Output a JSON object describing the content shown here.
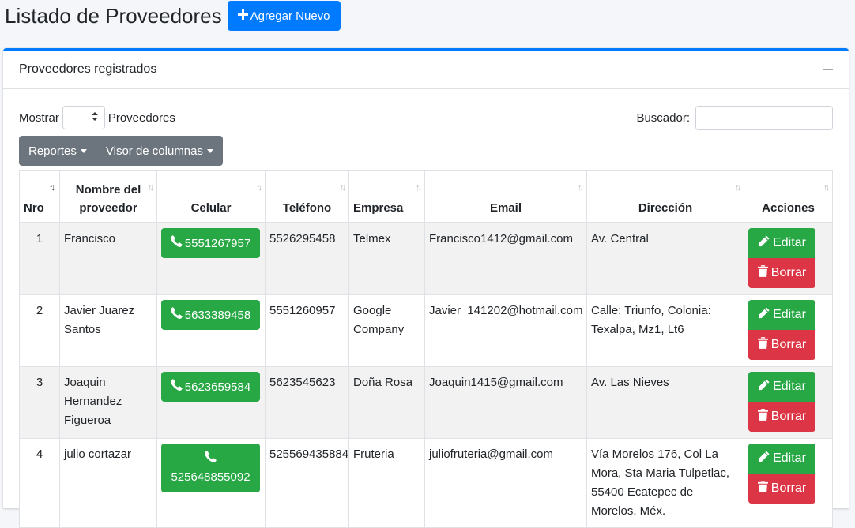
{
  "header": {
    "title": "Listado de Proveedores",
    "add_label": "Agregar Nuevo"
  },
  "card": {
    "title": "Proveedores registrados"
  },
  "controls": {
    "show_label": "Mostrar",
    "show_suffix": "Proveedores",
    "search_label": "Buscador:",
    "reports_label": "Reportes",
    "columns_label": "Visor de columnas"
  },
  "table": {
    "columns": [
      "Nro",
      "Nombre del proveedor",
      "Celular",
      "Teléfono",
      "Empresa",
      "Email",
      "Dirección",
      "Acciones"
    ],
    "edit_label": "Editar",
    "delete_label": "Borrar",
    "rows": [
      {
        "nro": "1",
        "nombre": "Francisco",
        "celular": "5551267957",
        "telefono": "5526295458",
        "empresa": "Telmex",
        "email": "Francisco1412@gmail.com",
        "direccion": "Av. Central"
      },
      {
        "nro": "2",
        "nombre": "Javier Juarez Santos",
        "celular": "5633389458",
        "telefono": "5551260957",
        "empresa": "Google Company",
        "email": "Javier_141202@hotmail.com",
        "direccion": "Calle: Triunfo, Colonia: Texalpa, Mz1, Lt6"
      },
      {
        "nro": "3",
        "nombre": "Joaquin Hernandez Figueroa",
        "celular": "5623659584",
        "telefono": "5623545623",
        "empresa": "Doña Rosa",
        "email": "Joaquin1415@gmail.com",
        "direccion": "Av. Las Nieves"
      },
      {
        "nro": "4",
        "nombre": "julio cortazar",
        "celular": "525648855092",
        "telefono": "525569435884",
        "empresa": "Fruteria",
        "email": "juliofruteria@gmail.com",
        "direccion": "Vía Morelos 176, Col La Mora, Sta Maria Tulpetlac, 55400 Ecatepec de Morelos, Méx."
      }
    ]
  }
}
